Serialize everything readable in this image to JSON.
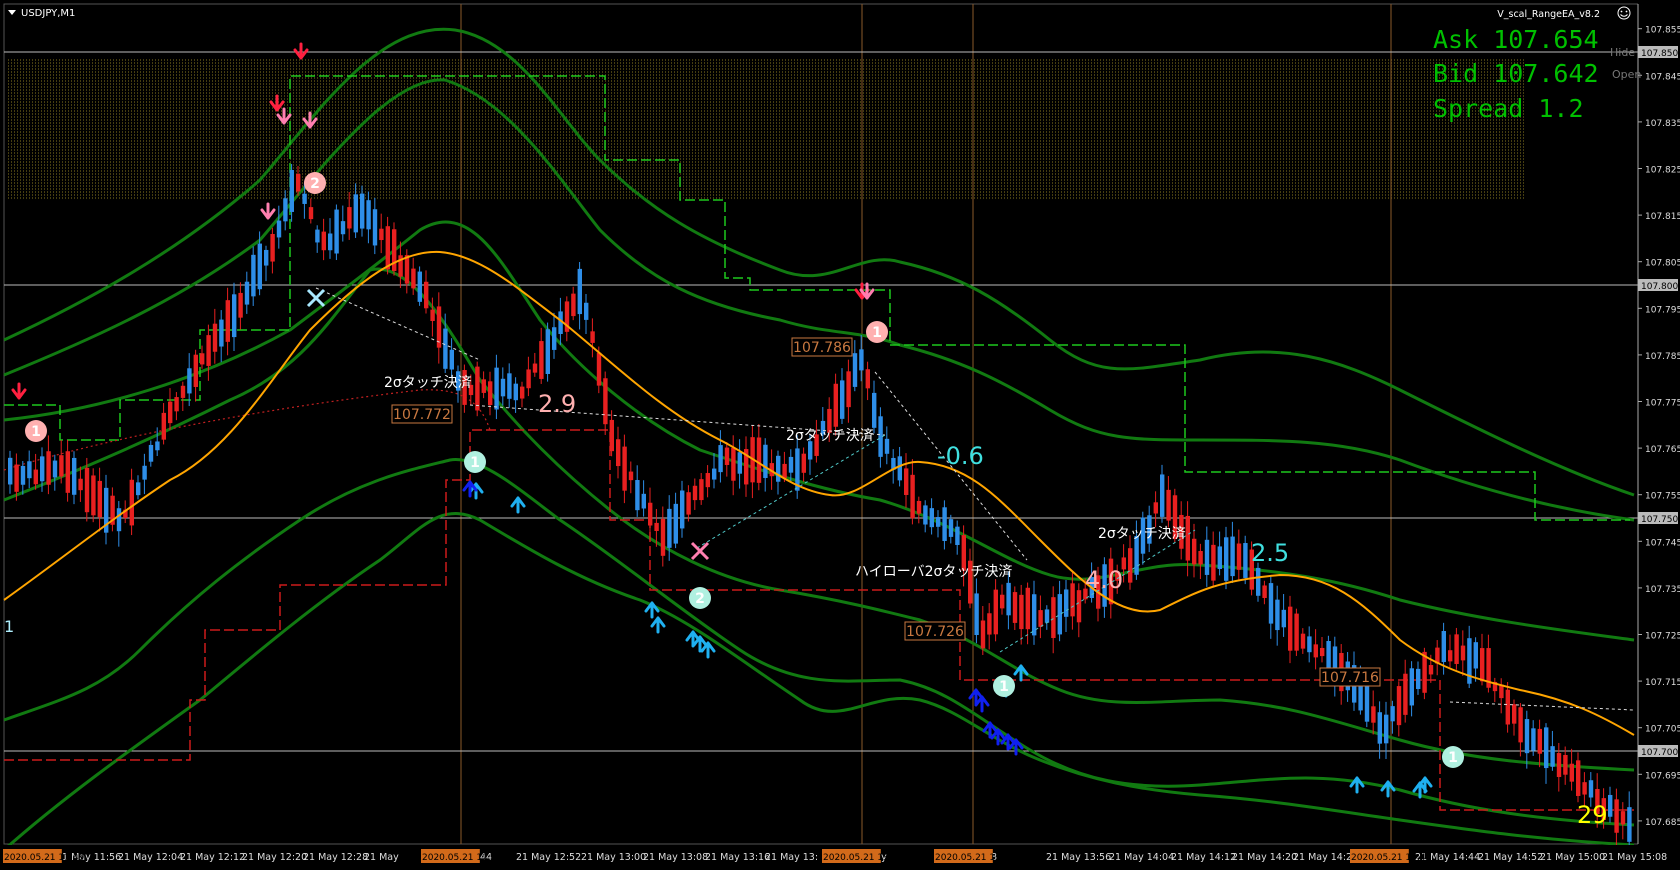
{
  "window": {
    "symbol_label": "USDJPY,M1",
    "ea_label": "V_scal_RangeEA_v8.2",
    "side_labels": [
      "Hide",
      "Open"
    ]
  },
  "quote": {
    "ask": "Ask 107.654",
    "bid": "Bid 107.642",
    "spread": "Spread 1.2"
  },
  "price_axis": {
    "ticks": [
      "107.855",
      "107.845",
      "107.835",
      "107.825",
      "107.815",
      "107.805",
      "107.795",
      "107.785",
      "107.775",
      "107.765",
      "107.755",
      "107.745",
      "107.735",
      "107.725",
      "107.715",
      "107.705",
      "107.695",
      "107.685"
    ],
    "hlines": [
      "107.850",
      "107.800",
      "107.750",
      "107.700"
    ]
  },
  "time_axis": {
    "labels": [
      "0",
      "21 May 11:56",
      "21 May 12:04",
      "21 May 12:12",
      "21 May 12:20",
      "21 May 12:28",
      "21 May",
      "44",
      "21 May 12:52",
      "21 May 13:00",
      "21 May 13:08",
      "21 May 13:16",
      "21 May 13:",
      "21 May",
      "48",
      "21 May 13:56",
      "21 May 14:04",
      "21 May 14:12",
      "21 May 14:20",
      "21 May 14:28",
      "21 May 14:44",
      "21 May 14:52",
      "21 May 15:00",
      "21 May 15:08"
    ],
    "highlights": [
      "2020.05.21 11:49",
      "2020.05.21 12:45",
      "2020.05.21 13:35",
      "2020.05.21 13:49",
      "2020.05.21 14:41"
    ]
  },
  "annotations": {
    "price_boxes": [
      "107.786",
      "107.772",
      "107.726",
      "107.716"
    ],
    "touch_labels": [
      "2σタッチ決済",
      "2σタッチ決済",
      "2σタッチ決済",
      "ハイローバ2σタッチ決済"
    ],
    "pnl_labels": [
      "2.9",
      "-0.6",
      "4.0",
      "2.5",
      "29"
    ],
    "circle_marks": [
      "1",
      "2",
      "1",
      "1",
      "2",
      "1",
      "1",
      "1",
      "1"
    ],
    "left_edge_mark": "1"
  },
  "colors": {
    "bull": "#2e8ee8",
    "bear": "#e82020",
    "bands": "#117a11",
    "ma": "#ffa500",
    "quote": "#00c000",
    "pnl_cyan": "#40e0e0",
    "pnl_yellow": "#ffff00",
    "up_arrow": "#1fb0f0",
    "down_arrow": "#ff2040",
    "time_highlight": "#d26a1a"
  }
}
